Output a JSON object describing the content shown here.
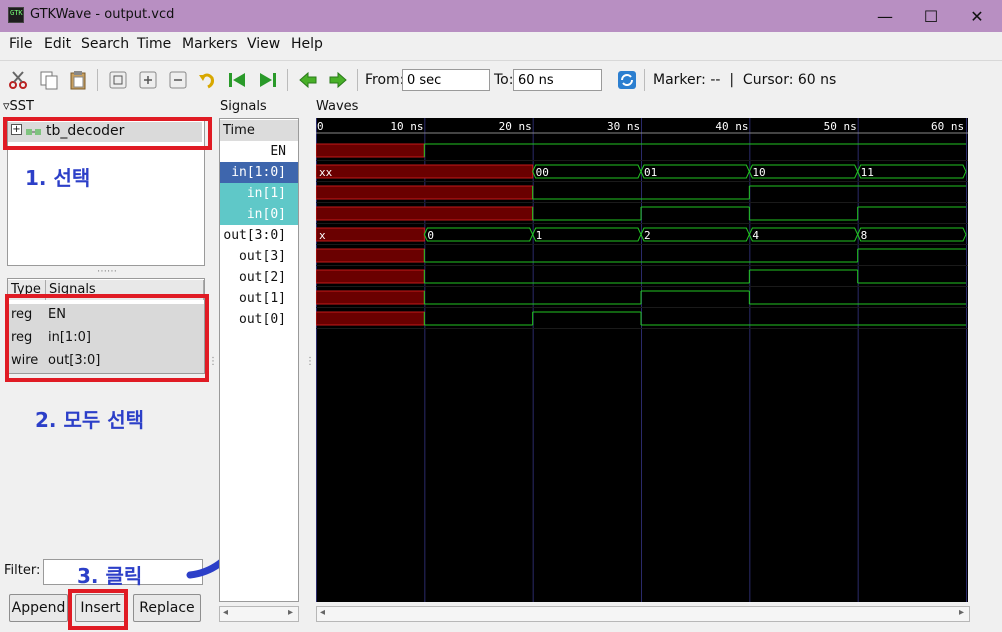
{
  "window": {
    "title": "GTKWave - output.vcd",
    "app_icon_text": "GTK",
    "minimize": "—",
    "maximize": "☐",
    "close": "✕"
  },
  "menu": [
    "File",
    "Edit",
    "Search",
    "Time",
    "Markers",
    "View",
    "Help"
  ],
  "toolbar": {
    "from_label": "From:",
    "from_value": "0 sec",
    "to_label": "To:",
    "to_value": "60 ns",
    "marker_cursor": "Marker: --  |  Cursor: 60 ns"
  },
  "sst": {
    "title": "SST",
    "tree_item": "tb_decoder",
    "expander": "+"
  },
  "signal_list": {
    "headers": [
      "Type",
      "Signals"
    ],
    "rows": [
      {
        "type": "reg",
        "name": "EN"
      },
      {
        "type": "reg",
        "name": "in[1:0]"
      },
      {
        "type": "wire",
        "name": "out[3:0]"
      }
    ]
  },
  "annotations": {
    "step1": "1. 선택",
    "step2": "2. 모두 선택",
    "step3": "3. 클릭"
  },
  "filter": {
    "label": "Filter:",
    "value": ""
  },
  "buttons": {
    "append": "Append",
    "insert": "Insert",
    "replace": "Replace"
  },
  "signals_panel": {
    "title": "Signals",
    "rows": [
      "Time",
      "EN",
      "in[1:0]",
      "in[1]",
      "in[0]",
      "out[3:0]",
      "out[3]",
      "out[2]",
      "out[1]",
      "out[0]"
    ]
  },
  "waves": {
    "title": "Waves",
    "time_labels": [
      "0",
      "10 ns",
      "20 ns",
      "30 ns",
      "40 ns",
      "50 ns",
      "60 ns"
    ],
    "time_max_ns": 60,
    "boundaries_ns": [
      0,
      10,
      20,
      30,
      40,
      50,
      60
    ],
    "colors": {
      "wave": "#22c422",
      "unknown_fill": "#6a0000",
      "unknown_line": "#c41a1a",
      "grid": "#2a2a6a",
      "highlight": "#3e66ad",
      "selected_sub": "#5fc8c8"
    },
    "signals": [
      {
        "name": "EN",
        "kind": "bit",
        "segments": [
          [
            "x",
            0,
            10
          ],
          [
            1,
            10,
            60
          ]
        ]
      },
      {
        "name": "in[1:0]",
        "kind": "bus",
        "segments": [
          [
            "xx",
            0,
            20
          ],
          [
            "00",
            20,
            30
          ],
          [
            "01",
            30,
            40
          ],
          [
            "10",
            40,
            50
          ],
          [
            "11",
            50,
            60
          ]
        ]
      },
      {
        "name": "in[1]",
        "kind": "bit",
        "segments": [
          [
            "x",
            0,
            20
          ],
          [
            0,
            20,
            40
          ],
          [
            1,
            40,
            60
          ]
        ]
      },
      {
        "name": "in[0]",
        "kind": "bit",
        "segments": [
          [
            "x",
            0,
            20
          ],
          [
            0,
            20,
            30
          ],
          [
            1,
            30,
            40
          ],
          [
            0,
            40,
            50
          ],
          [
            1,
            50,
            60
          ]
        ]
      },
      {
        "name": "out[3:0]",
        "kind": "bus",
        "segments": [
          [
            "x",
            0,
            10
          ],
          [
            "0",
            10,
            20
          ],
          [
            "1",
            20,
            30
          ],
          [
            "2",
            30,
            40
          ],
          [
            "4",
            40,
            50
          ],
          [
            "8",
            50,
            60
          ]
        ]
      },
      {
        "name": "out[3]",
        "kind": "bit",
        "segments": [
          [
            "x",
            0,
            10
          ],
          [
            0,
            10,
            50
          ],
          [
            1,
            50,
            60
          ]
        ]
      },
      {
        "name": "out[2]",
        "kind": "bit",
        "segments": [
          [
            "x",
            0,
            10
          ],
          [
            0,
            10,
            40
          ],
          [
            1,
            40,
            50
          ],
          [
            0,
            50,
            60
          ]
        ]
      },
      {
        "name": "out[1]",
        "kind": "bit",
        "segments": [
          [
            "x",
            0,
            10
          ],
          [
            0,
            10,
            30
          ],
          [
            1,
            30,
            40
          ],
          [
            0,
            40,
            60
          ]
        ]
      },
      {
        "name": "out[0]",
        "kind": "bit",
        "segments": [
          [
            "x",
            0,
            10
          ],
          [
            0,
            10,
            20
          ],
          [
            1,
            20,
            30
          ],
          [
            0,
            30,
            60
          ]
        ]
      }
    ]
  }
}
